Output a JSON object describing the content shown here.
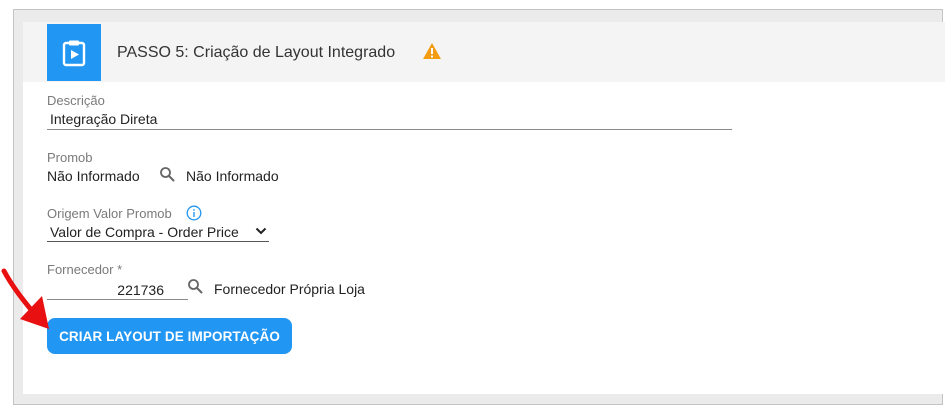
{
  "step": {
    "title": "PASSO 5: Criação de Layout Integrado",
    "icon": "clipboard-play-icon",
    "status_icon": "warning-icon",
    "status_color": "#f39c12"
  },
  "fields": {
    "descricao": {
      "label": "Descrição",
      "value": "Integração Direta"
    },
    "promob": {
      "label": "Promob",
      "value": "Não Informado",
      "lookup_value": "Não Informado"
    },
    "origem": {
      "label": "Origem Valor Promob",
      "value": "Valor de Compra - Order Price"
    },
    "fornecedor": {
      "label": "Fornecedor *",
      "value": "221736",
      "lookup_value": "Fornecedor Própria Loja"
    }
  },
  "actions": {
    "create_button": "CRIAR LAYOUT DE IMPORTAÇÃO"
  },
  "colors": {
    "primary": "#2196f3",
    "annotation": "#e81010"
  }
}
